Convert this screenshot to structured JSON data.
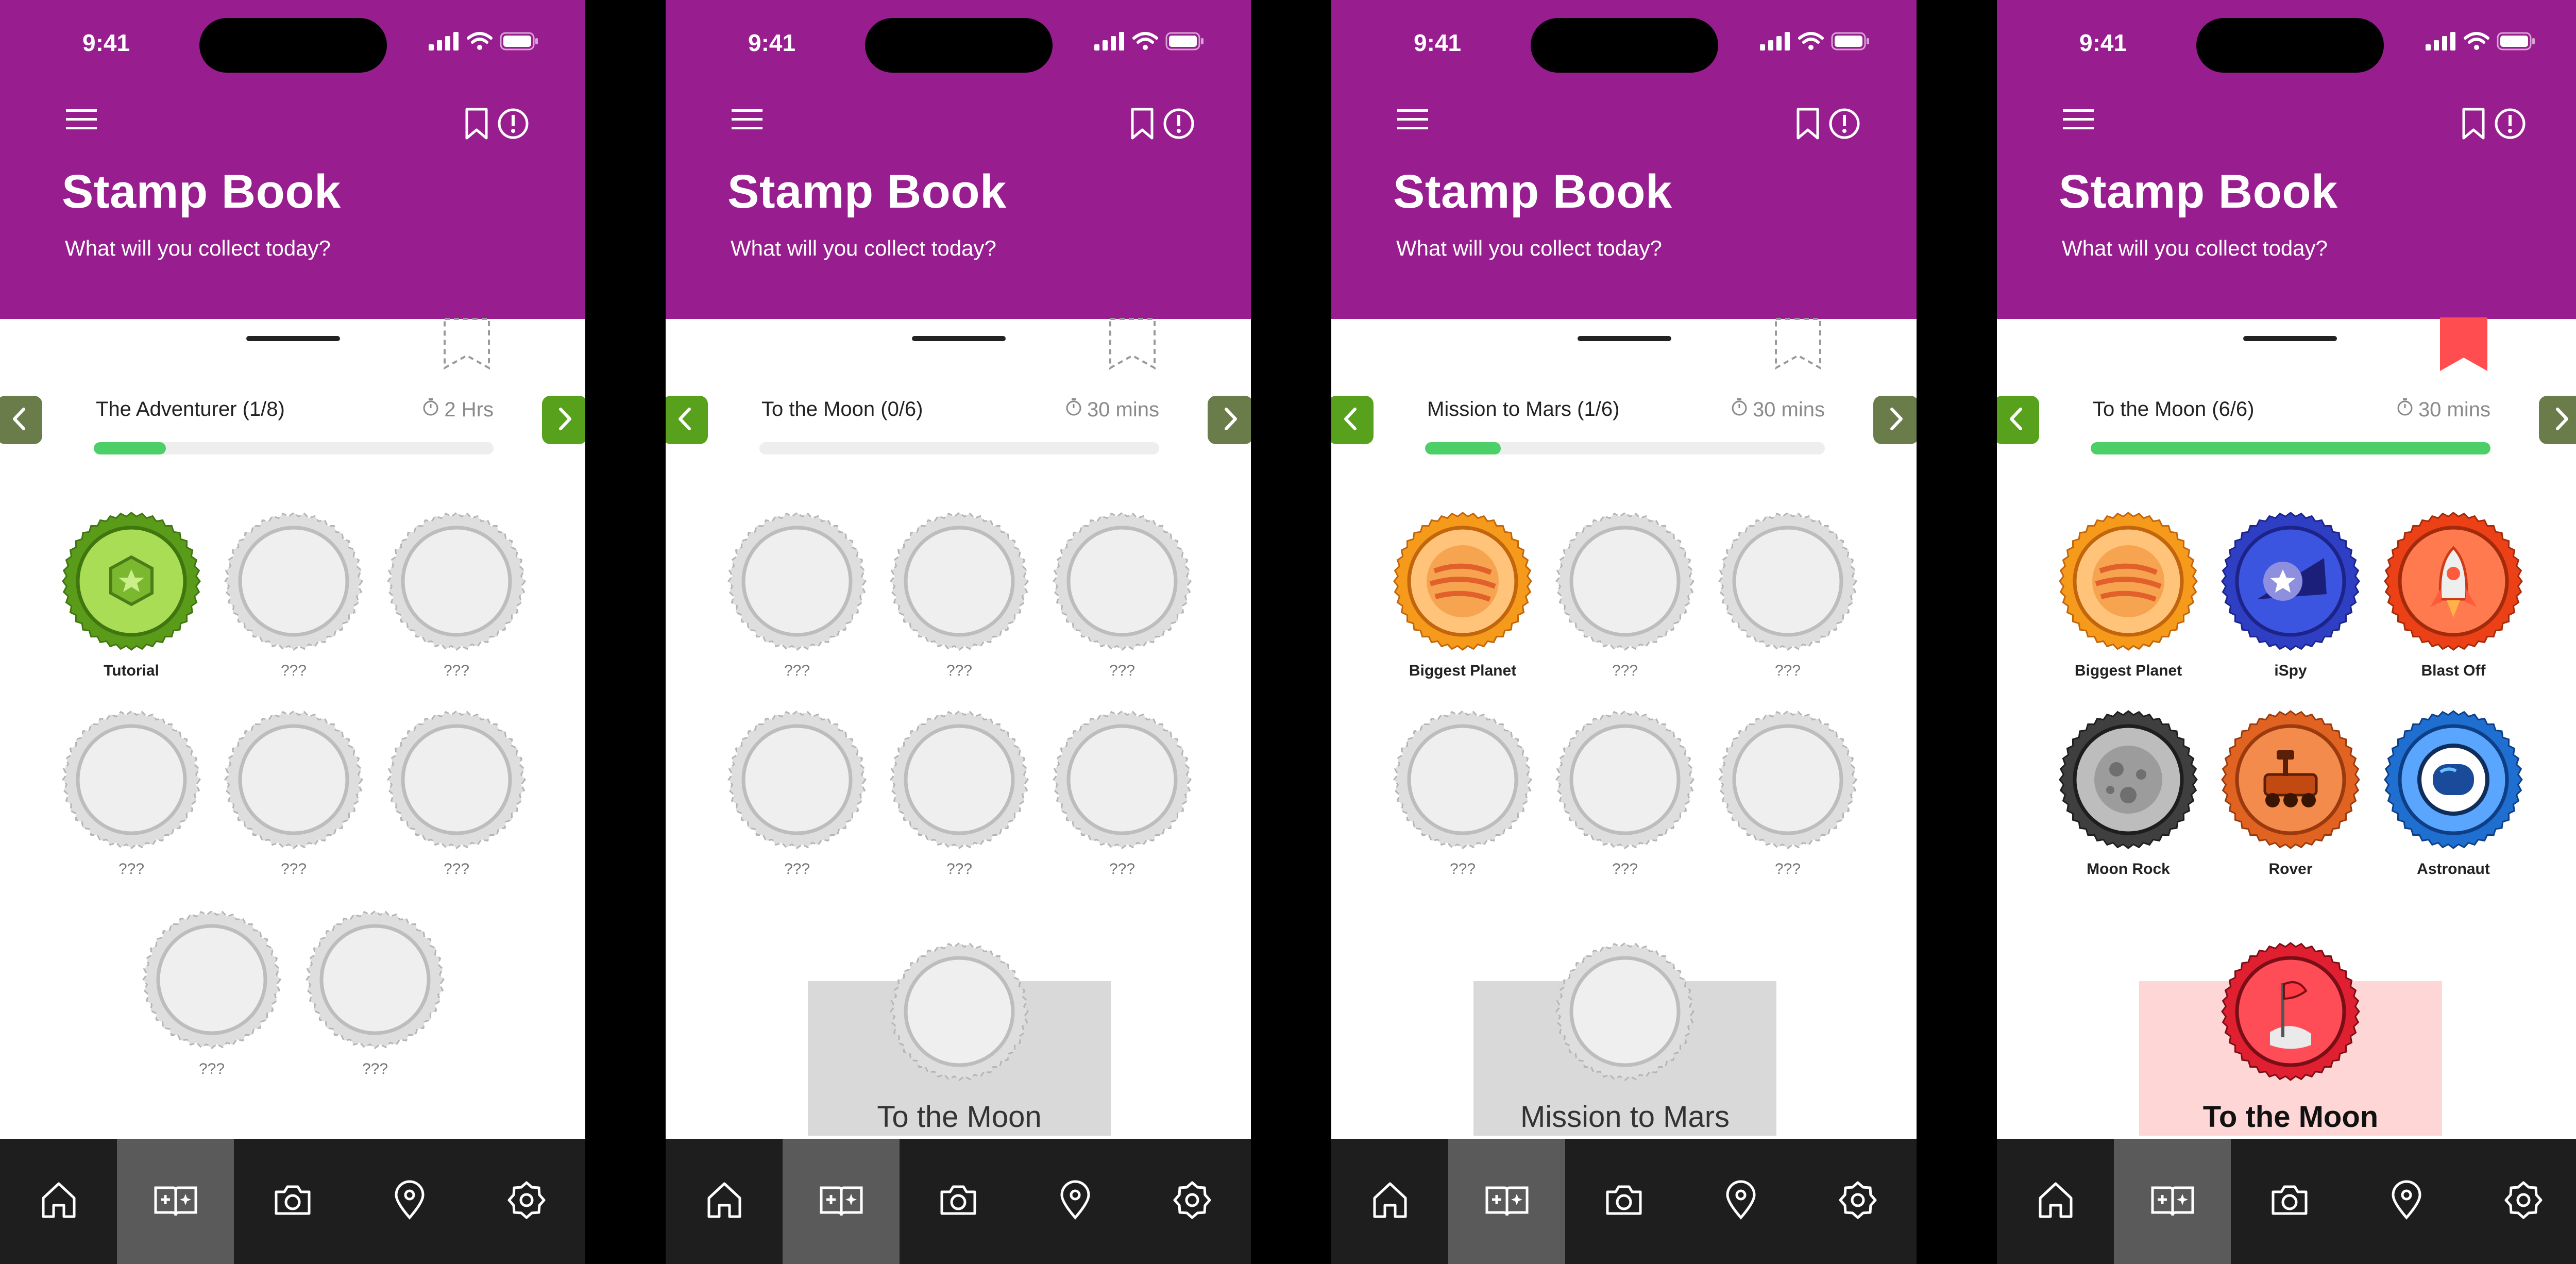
{
  "status_time": "9:41",
  "header": {
    "title": "Stamp Book",
    "subtitle": "What will you collect today?"
  },
  "colors": {
    "header": "#981e8f",
    "progress": "#4ccf67",
    "nav_active": "#57a11d",
    "nav_inactive": "#6b7c4b",
    "bookmark_active": "#ff4d50"
  },
  "icons": {
    "menu": "hamburger-menu-icon",
    "bookmark": "bookmark-icon",
    "info": "info-icon",
    "timer": "timer-icon",
    "prev": "chevron-left-icon",
    "next": "chevron-right-icon"
  },
  "tabs": [
    {
      "name": "home-icon"
    },
    {
      "name": "stamp-book-icon"
    },
    {
      "name": "camera-icon"
    },
    {
      "name": "map-pin-icon"
    },
    {
      "name": "settings-icon"
    }
  ],
  "screens": [
    {
      "quest": "The Adventurer (1/8)",
      "time": "2 Hrs",
      "progress": 0.18,
      "bookmarked": false,
      "prev_enabled": false,
      "next_enabled": true,
      "stamps": [
        {
          "label": "Tutorial",
          "art": "tutorial"
        },
        {
          "label": "???",
          "art": "empty"
        },
        {
          "label": "???",
          "art": "empty"
        },
        {
          "label": "???",
          "art": "empty"
        },
        {
          "label": "???",
          "art": "empty"
        },
        {
          "label": "???",
          "art": "empty"
        },
        {
          "label": "???",
          "art": "empty"
        },
        {
          "label": "???",
          "art": "empty"
        }
      ],
      "reward": null
    },
    {
      "quest": "To the Moon (0/6)",
      "time": "30 mins",
      "progress": 0,
      "bookmarked": false,
      "prev_enabled": true,
      "next_enabled": false,
      "stamps": [
        {
          "label": "???",
          "art": "empty"
        },
        {
          "label": "???",
          "art": "empty"
        },
        {
          "label": "???",
          "art": "empty"
        },
        {
          "label": "???",
          "art": "empty"
        },
        {
          "label": "???",
          "art": "empty"
        },
        {
          "label": "???",
          "art": "empty"
        }
      ],
      "reward": {
        "title": "To the Moon",
        "complete": false
      }
    },
    {
      "quest": "Mission to Mars (1/6)",
      "time": "30 mins",
      "progress": 0.19,
      "bookmarked": false,
      "prev_enabled": true,
      "next_enabled": false,
      "stamps": [
        {
          "label": "Biggest Planet",
          "art": "planet"
        },
        {
          "label": "???",
          "art": "empty"
        },
        {
          "label": "???",
          "art": "empty"
        },
        {
          "label": "???",
          "art": "empty"
        },
        {
          "label": "???",
          "art": "empty"
        },
        {
          "label": "???",
          "art": "empty"
        }
      ],
      "reward": {
        "title": "Mission to Mars",
        "complete": false
      }
    },
    {
      "quest": "To the Moon (6/6)",
      "time": "30 mins",
      "progress": 1,
      "bookmarked": true,
      "prev_enabled": true,
      "next_enabled": false,
      "stamps": [
        {
          "label": "Biggest Planet",
          "art": "planet"
        },
        {
          "label": "iSpy",
          "art": "ispy"
        },
        {
          "label": "Blast Off",
          "art": "rocket"
        },
        {
          "label": "Moon Rock",
          "art": "moonrock"
        },
        {
          "label": "Rover",
          "art": "rover"
        },
        {
          "label": "Astronaut",
          "art": "astronaut"
        }
      ],
      "reward": {
        "title": "To the Moon",
        "complete": true
      }
    }
  ]
}
